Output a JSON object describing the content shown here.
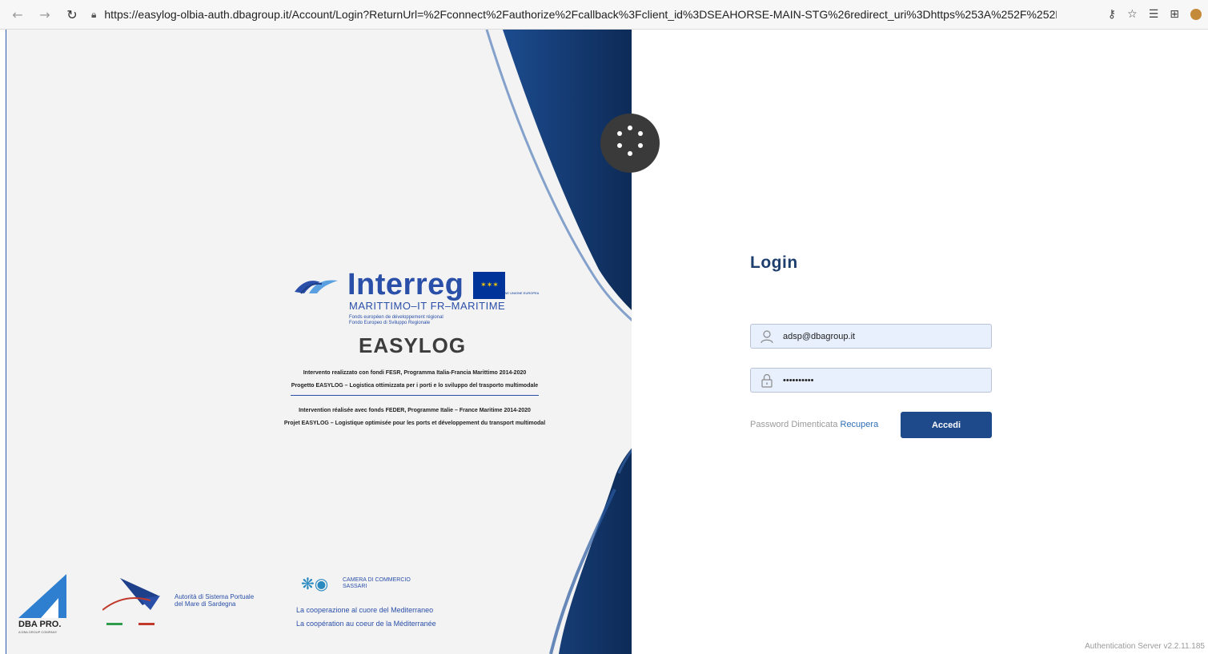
{
  "browser": {
    "url": "https://easylog-olbia-auth.dbagroup.it/Account/Login?ReturnUrl=%2Fconnect%2Fauthorize%2Fcallback%3Fclient_id%3DSEAHORSE-MAIN-STG%26redirect_uri%3Dhttps%253A%252F%252Feasylog-olbia.db..."
  },
  "branding": {
    "interreg": "Interreg",
    "eu_label": "UNION EUROPÉENNE UNIONE EUROPEA",
    "programme": "MARITTIMO–IT FR–MARITIME",
    "fund_fr": "Fonds européen de développement régional",
    "fund_it": "Fondo Europeo di Sviluppo Regionale",
    "project_logo": "EASYLOG",
    "line_it_1": "Intervento realizzato con fondi FESR, Programma Italia-Francia Marittimo 2014-2020",
    "line_it_2": "Progetto EASYLOG – Logistica ottimizzata per i porti e lo sviluppo del trasporto multimodale",
    "line_fr_1": "Intervention réalisée avec fonds FEDER, Programme Italie – France Maritime 2014-2020",
    "line_fr_2": "Projet EASYLOG – Logistique optimisée pour les ports et développement du transport multimodal"
  },
  "footer_logos": {
    "dba": "DBA PRO.",
    "dba_sub": "A DBA GROUP COMPANY",
    "asps_line1": "Autorità di Sistema Portuale",
    "asps_line2": "del Mare di Sardegna",
    "camera_line1": "CAMERA DI COMMERCIO",
    "camera_line2": "SASSARI",
    "coop_it": "La cooperazione al cuore del Mediterraneo",
    "coop_fr": "La coopération au coeur de la Méditerranée"
  },
  "login": {
    "title": "Login",
    "username_value": "adsp@dbagroup.it",
    "password_value": "••••••••••",
    "forgot_text": "Password Dimenticata",
    "recover_link": "Recupera",
    "submit_label": "Accedi"
  },
  "version": "Authentication Server v2.2.11.185",
  "colors": {
    "primary": "#1e4a8c",
    "title": "#1e3f6e",
    "wave_dark": "#0f2e5c",
    "interreg_blue": "#2a4fa8"
  },
  "icons": {
    "back": "arrow-left-icon",
    "forward": "arrow-right-icon",
    "reload": "reload-icon",
    "lock": "lock-icon",
    "user": "user-icon",
    "password": "padlock-icon"
  }
}
